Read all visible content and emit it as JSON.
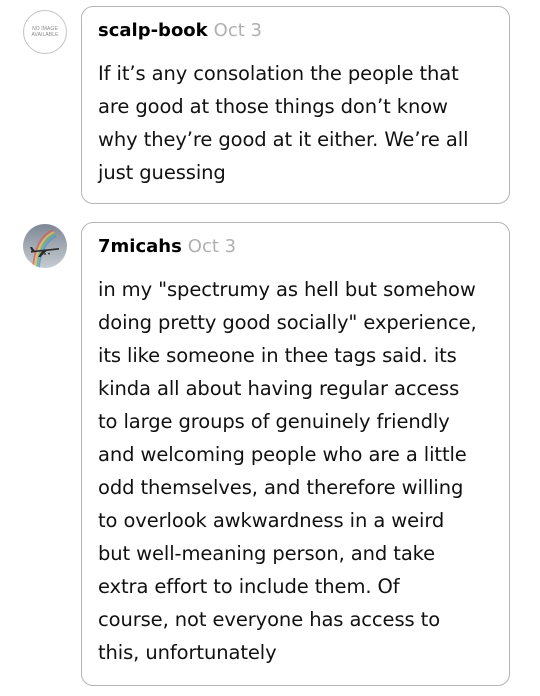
{
  "colors": {
    "bubble_border": "#b5b5b5",
    "date_text": "#b0b0b0",
    "body_text": "#111111",
    "avatar_sky": "#9aa3ad"
  },
  "replies": [
    {
      "avatar": {
        "type": "placeholder",
        "line1": "NO IMAGE",
        "line2": "AVAILABLE"
      },
      "username": "scalp-book",
      "date": "Oct 3",
      "text": "If it’s any consolation the people that\nare good at those things don’t know\nwhy they’re good at it either. We’re all\njust guessing"
    },
    {
      "avatar": {
        "type": "photo",
        "icon": "airplane-rainbow-icon"
      },
      "username": "7micahs",
      "date": "Oct 3",
      "text": "in my \"spectrumy as hell but somehow\ndoing pretty good socially\" experience,\nits like someone in thee tags said. its\nkinda all about having regular access\nto large groups of genuinely friendly\nand welcoming people who are a little\nodd themselves, and therefore willing\nto overlook awkwardness in a weird\nbut well-meaning person, and take\nextra effort to include them. Of\ncourse, not everyone has access to\nthis, unfortunately"
    }
  ]
}
